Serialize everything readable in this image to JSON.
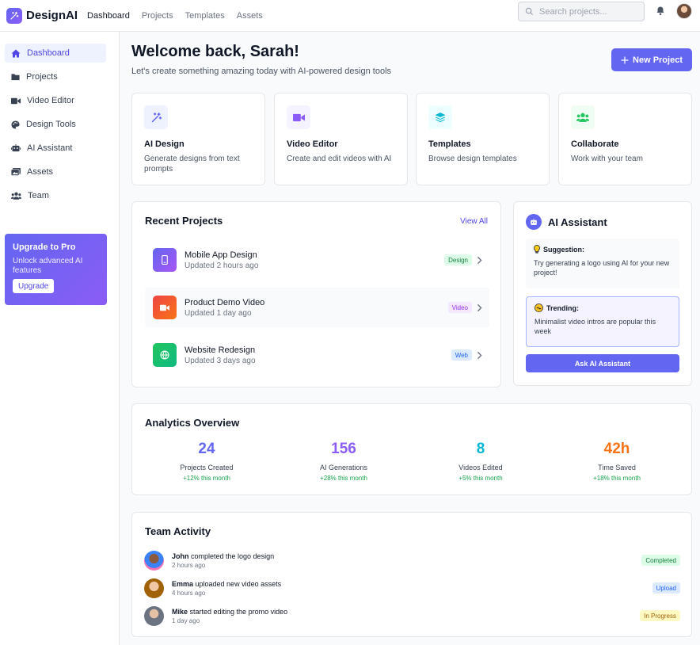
{
  "app": {
    "name": "DesignAI"
  },
  "topnav": [
    {
      "label": "Dashboard",
      "active": true
    },
    {
      "label": "Projects"
    },
    {
      "label": "Templates"
    },
    {
      "label": "Assets"
    }
  ],
  "search": {
    "placeholder": "Search projects..."
  },
  "sidebar": {
    "items": [
      {
        "label": "Dashboard",
        "icon": "home-icon",
        "active": true
      },
      {
        "label": "Projects",
        "icon": "folder-icon"
      },
      {
        "label": "Video Editor",
        "icon": "video-icon"
      },
      {
        "label": "Design Tools",
        "icon": "palette-icon"
      },
      {
        "label": "AI Assistant",
        "icon": "robot-icon"
      },
      {
        "label": "Assets",
        "icon": "images-icon"
      },
      {
        "label": "Team",
        "icon": "users-icon"
      }
    ],
    "upgrade": {
      "title": "Upgrade to Pro",
      "text": "Unlock advanced AI features",
      "button": "Upgrade"
    }
  },
  "header": {
    "title": "Welcome back, Sarah!",
    "subtitle": "Let's create something amazing today with AI-powered design tools",
    "new_project": "New Project"
  },
  "quick_actions": [
    {
      "title": "AI Design",
      "desc": "Generate designs from text prompts",
      "icon": "magic-wand-icon",
      "color": "#6366f1",
      "bg": "#eef2ff"
    },
    {
      "title": "Video Editor",
      "desc": "Create and edit videos with AI",
      "icon": "video-icon",
      "color": "#8b5cf6",
      "bg": "#f5f3ff"
    },
    {
      "title": "Templates",
      "desc": "Browse design templates",
      "icon": "layers-icon",
      "color": "#06b6d4",
      "bg": "#ecfeff"
    },
    {
      "title": "Collaborate",
      "desc": "Work with your team",
      "icon": "users-icon",
      "color": "#22c55e",
      "bg": "#f0fdf4"
    }
  ],
  "recent": {
    "title": "Recent Projects",
    "view_all": "View All",
    "projects": [
      {
        "name": "Mobile App Design",
        "time": "Updated 2 hours ago",
        "tag": "Design",
        "icon": "mobile-icon"
      },
      {
        "name": "Product Demo Video",
        "time": "Updated 1 day ago",
        "tag": "Video",
        "icon": "video-icon"
      },
      {
        "name": "Website Redesign",
        "time": "Updated 3 days ago",
        "tag": "Web",
        "icon": "globe-icon"
      }
    ]
  },
  "ai_assistant": {
    "title": "AI Assistant",
    "suggestion_title": "Suggestion:",
    "suggestion_text": "Try generating a logo using AI for your new project!",
    "trending_title": "Trending:",
    "trending_text": "Minimalist video intros are popular this week",
    "button": "Ask AI Assistant"
  },
  "analytics": {
    "title": "Analytics Overview",
    "stats": [
      {
        "value": "24",
        "label": "Projects Created",
        "change": "+12% this month",
        "color": "#6366f1"
      },
      {
        "value": "156",
        "label": "AI Generations",
        "change": "+28% this month",
        "color": "#8b5cf6"
      },
      {
        "value": "8",
        "label": "Videos Edited",
        "change": "+5% this month",
        "color": "#06b6d4"
      },
      {
        "value": "42h",
        "label": "Time Saved",
        "change": "+18% this month",
        "color": "#f97316"
      }
    ]
  },
  "team": {
    "title": "Team Activity",
    "activities": [
      {
        "user": "John",
        "action": " completed the logo design",
        "time": "2 hours ago",
        "status": "Completed"
      },
      {
        "user": "Emma",
        "action": " uploaded new video assets",
        "time": "4 hours ago",
        "status": "Upload"
      },
      {
        "user": "Mike",
        "action": " started editing the promo video",
        "time": "1 day ago",
        "status": "In Progress"
      }
    ]
  }
}
